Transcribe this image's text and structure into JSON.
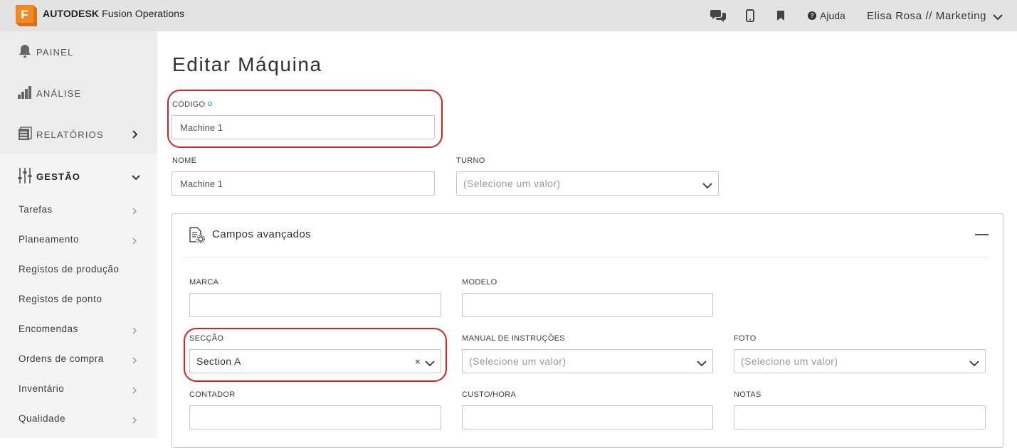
{
  "header": {
    "logo_letter": "F",
    "brand_bold": "AUTODESK",
    "brand_rest": "Fusion Operations",
    "help_label": "Ajuda",
    "user_label": "Elisa Rosa // Marketing",
    "accent": "#f08a24"
  },
  "sidebar": {
    "main": [
      {
        "label": "PAINEL",
        "icon": "bell-icon"
      },
      {
        "label": "ANÁLISE",
        "icon": "bar-chart-icon"
      },
      {
        "label": "RELATÓRIOS",
        "icon": "reports-icon"
      },
      {
        "label": "GESTÃO",
        "icon": "sliders-icon"
      }
    ],
    "sub": [
      {
        "label": "Tarefas"
      },
      {
        "label": "Planeamento"
      },
      {
        "label": "Registos de produção"
      },
      {
        "label": "Registos de ponto"
      },
      {
        "label": "Encomendas"
      },
      {
        "label": "Ordens de compra"
      },
      {
        "label": "Inventário"
      },
      {
        "label": "Qualidade"
      }
    ]
  },
  "form": {
    "title": "Editar Máquina",
    "codigo_label": "CÓDIGO",
    "codigo_value": "Machine 1",
    "nome_label": "NOME",
    "nome_value": "Machine 1",
    "turno_label": "TURNO",
    "turno_placeholder": "(Selecione um valor)",
    "advanced_title": "Campos avançados",
    "marca_label": "MARCA",
    "modelo_label": "MODELO",
    "seccao_label": "SECÇÃO",
    "seccao_value": "Section A",
    "manual_label": "MANUAL DE INSTRUÇÕES",
    "manual_placeholder": "(Selecione um valor)",
    "foto_label": "FOTO",
    "foto_placeholder": "(Selecione um valor)",
    "contador_label": "CONTADOR",
    "custo_label": "CUSTO/HORA",
    "notas_label": "NOTAS"
  }
}
